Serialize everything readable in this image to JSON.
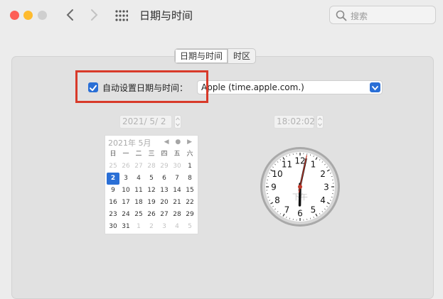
{
  "window": {
    "title": "日期与时间"
  },
  "search": {
    "placeholder": "搜索"
  },
  "tabs": [
    {
      "label": "日期与时间",
      "selected": true
    },
    {
      "label": "时区",
      "selected": false
    }
  ],
  "auto_set": {
    "label": "自动设置日期与时间：",
    "checked": true,
    "server": "Apple (time.apple.com.)"
  },
  "date_field": {
    "value": "2021/  5/  2"
  },
  "time_field": {
    "value": "18:02:02"
  },
  "calendar": {
    "month_label": "2021年 5月",
    "weekdays": [
      "日",
      "一",
      "二",
      "三",
      "四",
      "五",
      "六"
    ],
    "days": [
      [
        "25",
        "26",
        "27",
        "28",
        "29",
        "30",
        "1"
      ],
      [
        "2",
        "3",
        "4",
        "5",
        "6",
        "7",
        "8"
      ],
      [
        "9",
        "10",
        "11",
        "12",
        "13",
        "14",
        "15"
      ],
      [
        "16",
        "17",
        "18",
        "19",
        "20",
        "21",
        "22"
      ],
      [
        "23",
        "24",
        "25",
        "26",
        "27",
        "28",
        "29"
      ],
      [
        "30",
        "31",
        "1",
        "2",
        "3",
        "4",
        "5"
      ]
    ],
    "selected_day": "2"
  },
  "clock": {
    "numbers": [
      "12",
      "1",
      "2",
      "3",
      "4",
      "5",
      "6",
      "7",
      "8",
      "9",
      "10",
      "11"
    ],
    "ampm": "下午",
    "hour": 18,
    "minute": 2,
    "second": 2
  },
  "accent": "#2a6fd6",
  "highlight_color": "#d83a2a"
}
